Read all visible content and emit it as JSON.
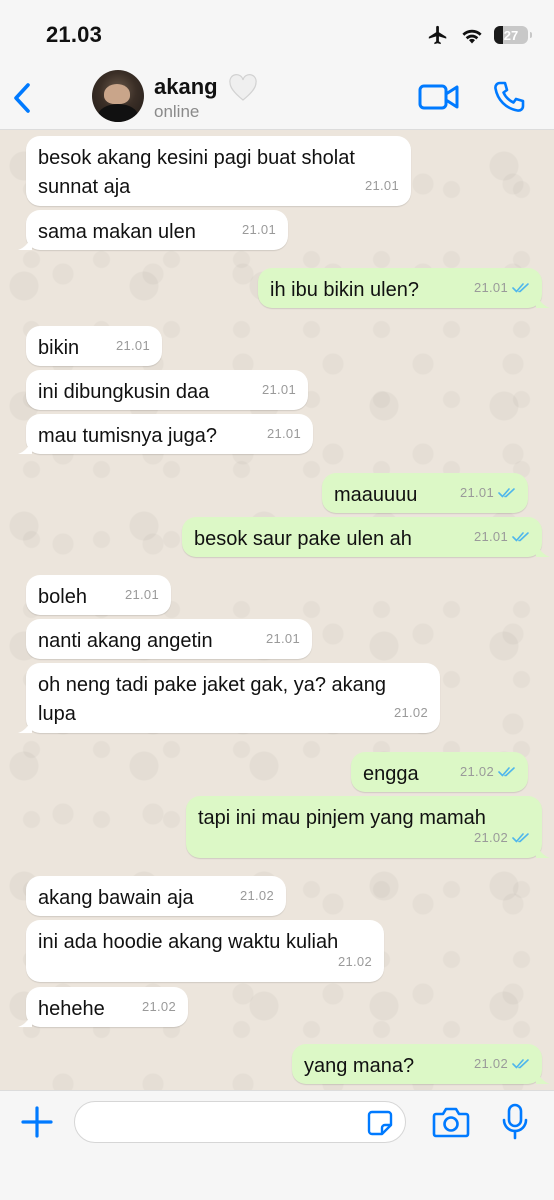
{
  "status_bar": {
    "time": "21.03",
    "battery": "27",
    "battery_level": 0.27
  },
  "header": {
    "name": "akang",
    "status": "online",
    "name_emoji_icon": "white-heart-icon"
  },
  "colors": {
    "accent": "#007aff",
    "incoming": "#ffffff",
    "outgoing": "#dcf8c6",
    "read_ticks": "#4fb6ec"
  },
  "messages": [
    {
      "dir": "in",
      "text": "besok akang kesini pagi buat sholat\nsunnat aja",
      "time": "21.01"
    },
    {
      "dir": "in",
      "text": "sama makan ulen",
      "time": "21.01"
    },
    {
      "dir": "out",
      "text": "ih ibu bikin ulen?",
      "time": "21.01",
      "read": true
    },
    {
      "dir": "in",
      "text": "bikin",
      "time": "21.01"
    },
    {
      "dir": "in",
      "text": "ini dibungkusin daa",
      "time": "21.01"
    },
    {
      "dir": "in",
      "text": "mau tumisnya juga?",
      "time": "21.01"
    },
    {
      "dir": "out",
      "text": "maauuuu",
      "time": "21.01",
      "read": true
    },
    {
      "dir": "out",
      "text": "besok saur pake ulen ah",
      "time": "21.01",
      "read": true
    },
    {
      "dir": "in",
      "text": "boleh",
      "time": "21.01"
    },
    {
      "dir": "in",
      "text": "nanti akang angetin",
      "time": "21.01"
    },
    {
      "dir": "in",
      "text": "oh neng tadi pake jaket gak, ya? akang\nlupa",
      "time": "21.02"
    },
    {
      "dir": "out",
      "text": "engga",
      "time": "21.02",
      "read": true
    },
    {
      "dir": "out",
      "text": "tapi ini mau pinjem yang mamah",
      "time": "21.02",
      "read": true
    },
    {
      "dir": "in",
      "text": "akang bawain aja",
      "time": "21.02"
    },
    {
      "dir": "in",
      "text": "ini ada hoodie akang waktu kuliah",
      "time": "21.02"
    },
    {
      "dir": "in",
      "text": "hehehe",
      "time": "21.02"
    },
    {
      "dir": "out",
      "text": "yang mana?",
      "time": "21.02",
      "read": true
    }
  ],
  "input": {
    "value": "",
    "placeholder": ""
  }
}
